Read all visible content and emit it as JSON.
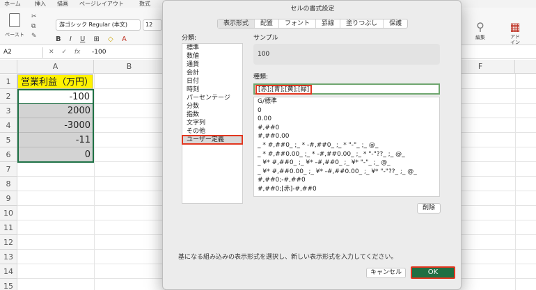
{
  "ribbon": {
    "tabs": [
      "ホーム",
      "挿入",
      "描画",
      "ページレイアウト",
      "数式"
    ],
    "paste_label": "ペースト",
    "font_name": "游ゴシック Regular (本文)",
    "font_size": "12",
    "format_buttons": [
      "B",
      "I",
      "U",
      "⊞",
      "◇",
      "A"
    ],
    "edit_label": "編集",
    "addin_label": "アド\nイン"
  },
  "formula_bar": {
    "name_box": "A2",
    "cancel_icon": "✕",
    "confirm_icon": "✓",
    "fx_icon": "fx",
    "value": "-100"
  },
  "columns": [
    "A",
    "B",
    "F"
  ],
  "rows": [
    "1",
    "2",
    "3",
    "4",
    "5",
    "6",
    "7",
    "8",
    "9",
    "10",
    "11",
    "12",
    "13",
    "14",
    "15"
  ],
  "cells": {
    "a1": "営業利益（万円）",
    "a2": "-100",
    "a3": "2000",
    "a4": "-3000",
    "a5": "-11",
    "a6": "0"
  },
  "dialog": {
    "title": "セルの書式設定",
    "tabs": [
      "表示形式",
      "配置",
      "フォント",
      "罫線",
      "塗りつぶし",
      "保護"
    ],
    "category_label": "分類:",
    "categories": [
      "標準",
      "数値",
      "通貨",
      "会計",
      "日付",
      "時刻",
      "パーセンテージ",
      "分数",
      "指数",
      "文字列",
      "その他",
      "ユーザー定義"
    ],
    "sample_label": "サンプル",
    "sample_value": "100",
    "type_label": "種類:",
    "type_value": "[赤];[青];[黄];[緑]",
    "format_list": [
      "G/標準",
      "0",
      "0.00",
      "#,##0",
      "#,##0.00",
      "_ * #,##0_ ;_ * -#,##0_ ;_ * \"-\"_ ;_ @_",
      "_ * #,##0.00_ ;_ * -#,##0.00_ ;_ * \"-\"??_ ;_ @_",
      "_ ¥* #,##0_ ;_ ¥* -#,##0_ ;_ ¥* \"-\"_ ;_ @_",
      "_ ¥* #,##0.00_ ;_ ¥* -#,##0.00_ ;_ ¥* \"-\"??_ ;_ @_",
      "#,##0;-#,##0",
      "#,##0;[赤]-#,##0"
    ],
    "delete_label": "削除",
    "hint": "基になる組み込みの表示形式を選択し、新しい表示形式を入力してください。",
    "cancel_label": "キャンセル",
    "ok_label": "OK"
  },
  "colors": {
    "excel_green": "#1e7145",
    "highlight_red": "#e2361f",
    "header_yellow": "#fff200"
  }
}
